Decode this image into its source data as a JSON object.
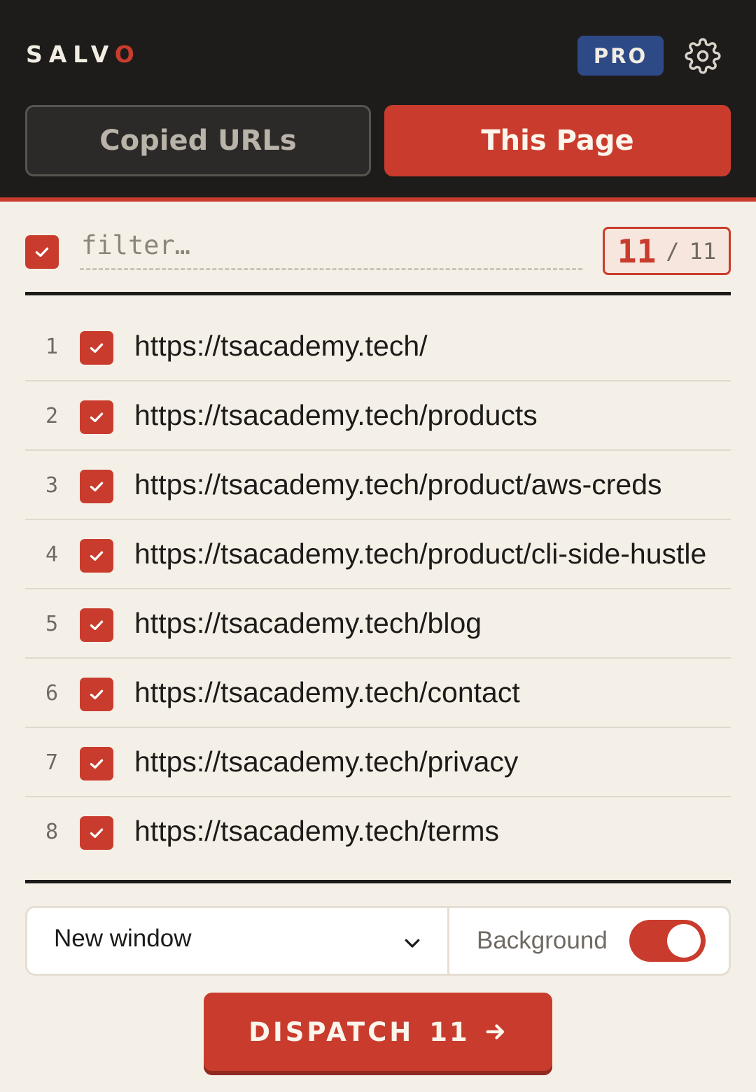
{
  "app": {
    "logo_main": "SALV",
    "logo_accent": "O",
    "plan_badge": "PRO",
    "settings_icon": "gear-icon"
  },
  "tabs": [
    {
      "label": "Copied URLs",
      "active": false
    },
    {
      "label": "This Page",
      "active": true
    }
  ],
  "filter": {
    "placeholder": "filter…",
    "value": "",
    "select_all_checked": true,
    "selected_count": "11",
    "separator": "/",
    "total_count": "11"
  },
  "urls": [
    {
      "num": "1",
      "url": "https://tsacademy.tech/",
      "checked": true
    },
    {
      "num": "2",
      "url": "https://tsacademy.tech/products",
      "checked": true
    },
    {
      "num": "3",
      "url": "https://tsacademy.tech/product/aws-creds",
      "checked": true
    },
    {
      "num": "4",
      "url": "https://tsacademy.tech/product/cli-side-hustle",
      "checked": true
    },
    {
      "num": "5",
      "url": "https://tsacademy.tech/blog",
      "checked": true
    },
    {
      "num": "6",
      "url": "https://tsacademy.tech/contact",
      "checked": true
    },
    {
      "num": "7",
      "url": "https://tsacademy.tech/privacy",
      "checked": true
    },
    {
      "num": "8",
      "url": "https://tsacademy.tech/terms",
      "checked": true
    }
  ],
  "options": {
    "open_mode": "New window",
    "background_label": "Background",
    "background_enabled": true
  },
  "dispatch": {
    "label": "DISPATCH",
    "count": "11",
    "icon": "arrow-right-icon"
  },
  "colors": {
    "accent": "#c93c2d",
    "header_bg": "#1e1c1a",
    "page_bg": "#f5f0e7",
    "pro_badge": "#2e4a86"
  }
}
